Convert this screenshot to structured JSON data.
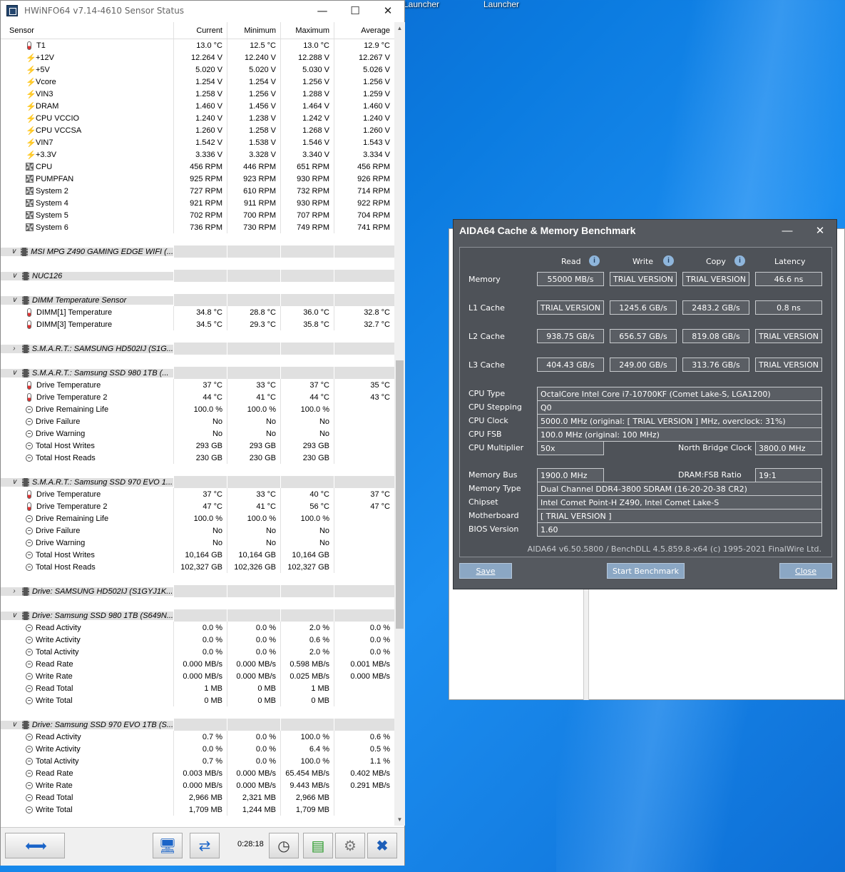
{
  "desktop": {
    "icon_labels": [
      "Launcher",
      "Launcher"
    ]
  },
  "hwinfo": {
    "title": "HWiNFO64 v7.14-4610 Sensor Status",
    "columns": [
      "Sensor",
      "Current",
      "Minimum",
      "Maximum",
      "Average"
    ],
    "timer": "0:28:18",
    "rows": [
      {
        "t": "s",
        "icon": "temp",
        "name": "T1",
        "v": [
          "13.0 °C",
          "12.5 °C",
          "13.0 °C",
          "12.9 °C"
        ]
      },
      {
        "t": "s",
        "icon": "volt",
        "name": "+12V",
        "v": [
          "12.264 V",
          "12.240 V",
          "12.288 V",
          "12.267 V"
        ]
      },
      {
        "t": "s",
        "icon": "volt",
        "name": "+5V",
        "v": [
          "5.020 V",
          "5.020 V",
          "5.030 V",
          "5.026 V"
        ]
      },
      {
        "t": "s",
        "icon": "volt",
        "name": "Vcore",
        "v": [
          "1.254 V",
          "1.254 V",
          "1.256 V",
          "1.256 V"
        ]
      },
      {
        "t": "s",
        "icon": "volt",
        "name": "VIN3",
        "v": [
          "1.258 V",
          "1.256 V",
          "1.288 V",
          "1.259 V"
        ]
      },
      {
        "t": "s",
        "icon": "volt",
        "name": "DRAM",
        "v": [
          "1.460 V",
          "1.456 V",
          "1.464 V",
          "1.460 V"
        ]
      },
      {
        "t": "s",
        "icon": "volt",
        "name": "CPU VCCIO",
        "v": [
          "1.240 V",
          "1.238 V",
          "1.242 V",
          "1.240 V"
        ]
      },
      {
        "t": "s",
        "icon": "volt",
        "name": "CPU VCCSA",
        "v": [
          "1.260 V",
          "1.258 V",
          "1.268 V",
          "1.260 V"
        ]
      },
      {
        "t": "s",
        "icon": "volt",
        "name": "VIN7",
        "v": [
          "1.542 V",
          "1.538 V",
          "1.546 V",
          "1.543 V"
        ]
      },
      {
        "t": "s",
        "icon": "volt",
        "name": "+3.3V",
        "v": [
          "3.336 V",
          "3.328 V",
          "3.340 V",
          "3.334 V"
        ]
      },
      {
        "t": "s",
        "icon": "fan",
        "name": "CPU",
        "v": [
          "456 RPM",
          "446 RPM",
          "651 RPM",
          "456 RPM"
        ]
      },
      {
        "t": "s",
        "icon": "fan",
        "name": "PUMPFAN",
        "v": [
          "925 RPM",
          "923 RPM",
          "930 RPM",
          "926 RPM"
        ]
      },
      {
        "t": "s",
        "icon": "fan",
        "name": "System 2",
        "v": [
          "727 RPM",
          "610 RPM",
          "732 RPM",
          "714 RPM"
        ]
      },
      {
        "t": "s",
        "icon": "fan",
        "name": "System 4",
        "v": [
          "921 RPM",
          "911 RPM",
          "930 RPM",
          "922 RPM"
        ]
      },
      {
        "t": "s",
        "icon": "fan",
        "name": "System 5",
        "v": [
          "702 RPM",
          "700 RPM",
          "707 RPM",
          "704 RPM"
        ]
      },
      {
        "t": "s",
        "icon": "fan",
        "name": "System 6",
        "v": [
          "736 RPM",
          "730 RPM",
          "749 RPM",
          "741 RPM"
        ]
      },
      {
        "t": "e"
      },
      {
        "t": "g",
        "open": true,
        "name": "MSI MPG Z490 GAMING EDGE WIFI (..."
      },
      {
        "t": "e"
      },
      {
        "t": "g",
        "open": true,
        "name": "NUC126"
      },
      {
        "t": "e"
      },
      {
        "t": "g",
        "open": true,
        "name": "DIMM Temperature Sensor"
      },
      {
        "t": "s",
        "icon": "temp",
        "name": "DIMM[1] Temperature",
        "v": [
          "34.8 °C",
          "28.8 °C",
          "36.0 °C",
          "32.8 °C"
        ]
      },
      {
        "t": "s",
        "icon": "temp",
        "name": "DIMM[3] Temperature",
        "v": [
          "34.5 °C",
          "29.3 °C",
          "35.8 °C",
          "32.7 °C"
        ]
      },
      {
        "t": "e"
      },
      {
        "t": "g",
        "open": false,
        "name": "S.M.A.R.T.: SAMSUNG HD502IJ (S1G..."
      },
      {
        "t": "e"
      },
      {
        "t": "g",
        "open": true,
        "name": "S.M.A.R.T.: Samsung SSD 980 1TB (..."
      },
      {
        "t": "s",
        "icon": "temp",
        "name": "Drive Temperature",
        "v": [
          "37 °C",
          "33 °C",
          "37 °C",
          "35 °C"
        ]
      },
      {
        "t": "s",
        "icon": "temp",
        "name": "Drive Temperature 2",
        "v": [
          "44 °C",
          "41 °C",
          "44 °C",
          "43 °C"
        ]
      },
      {
        "t": "s",
        "icon": "circ",
        "name": "Drive Remaining Life",
        "v": [
          "100.0 %",
          "100.0 %",
          "100.0 %",
          ""
        ]
      },
      {
        "t": "s",
        "icon": "circ",
        "name": "Drive Failure",
        "v": [
          "No",
          "No",
          "No",
          ""
        ]
      },
      {
        "t": "s",
        "icon": "circ",
        "name": "Drive Warning",
        "v": [
          "No",
          "No",
          "No",
          ""
        ]
      },
      {
        "t": "s",
        "icon": "circ",
        "name": "Total Host Writes",
        "v": [
          "293 GB",
          "293 GB",
          "293 GB",
          ""
        ]
      },
      {
        "t": "s",
        "icon": "circ",
        "name": "Total Host Reads",
        "v": [
          "230 GB",
          "230 GB",
          "230 GB",
          ""
        ]
      },
      {
        "t": "e"
      },
      {
        "t": "g",
        "open": true,
        "name": "S.M.A.R.T.: Samsung SSD 970 EVO 1..."
      },
      {
        "t": "s",
        "icon": "temp",
        "name": "Drive Temperature",
        "v": [
          "37 °C",
          "33 °C",
          "40 °C",
          "37 °C"
        ]
      },
      {
        "t": "s",
        "icon": "temp",
        "name": "Drive Temperature 2",
        "v": [
          "47 °C",
          "41 °C",
          "56 °C",
          "47 °C"
        ]
      },
      {
        "t": "s",
        "icon": "circ",
        "name": "Drive Remaining Life",
        "v": [
          "100.0 %",
          "100.0 %",
          "100.0 %",
          ""
        ]
      },
      {
        "t": "s",
        "icon": "circ",
        "name": "Drive Failure",
        "v": [
          "No",
          "No",
          "No",
          ""
        ]
      },
      {
        "t": "s",
        "icon": "circ",
        "name": "Drive Warning",
        "v": [
          "No",
          "No",
          "No",
          ""
        ]
      },
      {
        "t": "s",
        "icon": "circ",
        "name": "Total Host Writes",
        "v": [
          "10,164 GB",
          "10,164 GB",
          "10,164 GB",
          ""
        ]
      },
      {
        "t": "s",
        "icon": "circ",
        "name": "Total Host Reads",
        "v": [
          "102,327 GB",
          "102,326 GB",
          "102,327 GB",
          ""
        ]
      },
      {
        "t": "e"
      },
      {
        "t": "g",
        "open": false,
        "name": "Drive: SAMSUNG HD502IJ (S1GYJ1K..."
      },
      {
        "t": "e"
      },
      {
        "t": "g",
        "open": true,
        "name": "Drive: Samsung SSD 980 1TB (S649N..."
      },
      {
        "t": "s",
        "icon": "circ",
        "name": "Read Activity",
        "v": [
          "0.0 %",
          "0.0 %",
          "2.0 %",
          "0.0 %"
        ]
      },
      {
        "t": "s",
        "icon": "circ",
        "name": "Write Activity",
        "v": [
          "0.0 %",
          "0.0 %",
          "0.6 %",
          "0.0 %"
        ]
      },
      {
        "t": "s",
        "icon": "circ",
        "name": "Total Activity",
        "v": [
          "0.0 %",
          "0.0 %",
          "2.0 %",
          "0.0 %"
        ]
      },
      {
        "t": "s",
        "icon": "circ",
        "name": "Read Rate",
        "v": [
          "0.000 MB/s",
          "0.000 MB/s",
          "0.598 MB/s",
          "0.001 MB/s"
        ]
      },
      {
        "t": "s",
        "icon": "circ",
        "name": "Write Rate",
        "v": [
          "0.000 MB/s",
          "0.000 MB/s",
          "0.025 MB/s",
          "0.000 MB/s"
        ]
      },
      {
        "t": "s",
        "icon": "circ",
        "name": "Read Total",
        "v": [
          "1 MB",
          "0 MB",
          "1 MB",
          ""
        ]
      },
      {
        "t": "s",
        "icon": "circ",
        "name": "Write Total",
        "v": [
          "0 MB",
          "0 MB",
          "0 MB",
          ""
        ]
      },
      {
        "t": "e"
      },
      {
        "t": "g",
        "open": true,
        "name": "Drive: Samsung SSD 970 EVO 1TB (S..."
      },
      {
        "t": "s",
        "icon": "circ",
        "name": "Read Activity",
        "v": [
          "0.7 %",
          "0.0 %",
          "100.0 %",
          "0.6 %"
        ]
      },
      {
        "t": "s",
        "icon": "circ",
        "name": "Write Activity",
        "v": [
          "0.0 %",
          "0.0 %",
          "6.4 %",
          "0.5 %"
        ]
      },
      {
        "t": "s",
        "icon": "circ",
        "name": "Total Activity",
        "v": [
          "0.7 %",
          "0.0 %",
          "100.0 %",
          "1.1 %"
        ]
      },
      {
        "t": "s",
        "icon": "circ",
        "name": "Read Rate",
        "v": [
          "0.003 MB/s",
          "0.000 MB/s",
          "65.454 MB/s",
          "0.402 MB/s"
        ]
      },
      {
        "t": "s",
        "icon": "circ",
        "name": "Write Rate",
        "v": [
          "0.000 MB/s",
          "0.000 MB/s",
          "9.443 MB/s",
          "0.291 MB/s"
        ]
      },
      {
        "t": "s",
        "icon": "circ",
        "name": "Read Total",
        "v": [
          "2,966 MB",
          "2,321 MB",
          "2,966 MB",
          ""
        ]
      },
      {
        "t": "s",
        "icon": "circ",
        "name": "Write Total",
        "v": [
          "1,709 MB",
          "1,244 MB",
          "1,709 MB",
          ""
        ]
      }
    ]
  },
  "aida": {
    "title": "AIDA64 Cache & Memory Benchmark",
    "col_headers": [
      "Read",
      "Write",
      "Copy",
      "Latency"
    ],
    "bench": [
      {
        "label": "Memory",
        "vals": [
          "55000 MB/s",
          "TRIAL VERSION",
          "TRIAL VERSION",
          "46.6 ns"
        ]
      },
      {
        "label": "L1 Cache",
        "vals": [
          "TRIAL VERSION",
          "1245.6 GB/s",
          "2483.2 GB/s",
          "0.8 ns"
        ]
      },
      {
        "label": "L2 Cache",
        "vals": [
          "938.75 GB/s",
          "656.57 GB/s",
          "819.08 GB/s",
          "TRIAL VERSION"
        ]
      },
      {
        "label": "L3 Cache",
        "vals": [
          "404.43 GB/s",
          "249.00 GB/s",
          "313.76 GB/s",
          "TRIAL VERSION"
        ]
      }
    ],
    "info": {
      "cpu_type_label": "CPU Type",
      "cpu_type": "OctalCore Intel Core i7-10700KF  (Comet Lake-S, LGA1200)",
      "cpu_stepping_label": "CPU Stepping",
      "cpu_stepping": "Q0",
      "cpu_clock_label": "CPU Clock",
      "cpu_clock": "5000.0 MHz  (original: [ TRIAL VERSION ] MHz, overclock: 31%)",
      "cpu_fsb_label": "CPU FSB",
      "cpu_fsb": "100.0 MHz  (original: 100 MHz)",
      "cpu_mult_label": "CPU Multiplier",
      "cpu_mult": "50x",
      "nb_clock_label": "North Bridge Clock",
      "nb_clock": "3800.0 MHz",
      "mem_bus_label": "Memory Bus",
      "mem_bus": "1900.0 MHz",
      "dram_ratio_label": "DRAM:FSB Ratio",
      "dram_ratio": "19:1",
      "mem_type_label": "Memory Type",
      "mem_type": "Dual Channel DDR4-3800 SDRAM  (16-20-20-38 CR2)",
      "chipset_label": "Chipset",
      "chipset": "Intel Comet Point-H Z490, Intel Comet Lake-S",
      "mobo_label": "Motherboard",
      "mobo": "[ TRIAL VERSION ]",
      "bios_label": "BIOS Version",
      "bios": "1.60"
    },
    "footer": "AIDA64 v6.50.5800 / BenchDLL 4.5.859.8-x64  (c) 1995-2021 FinalWire Ltd.",
    "buttons": {
      "save": "Save",
      "start": "Start Benchmark",
      "close": "Close"
    }
  }
}
